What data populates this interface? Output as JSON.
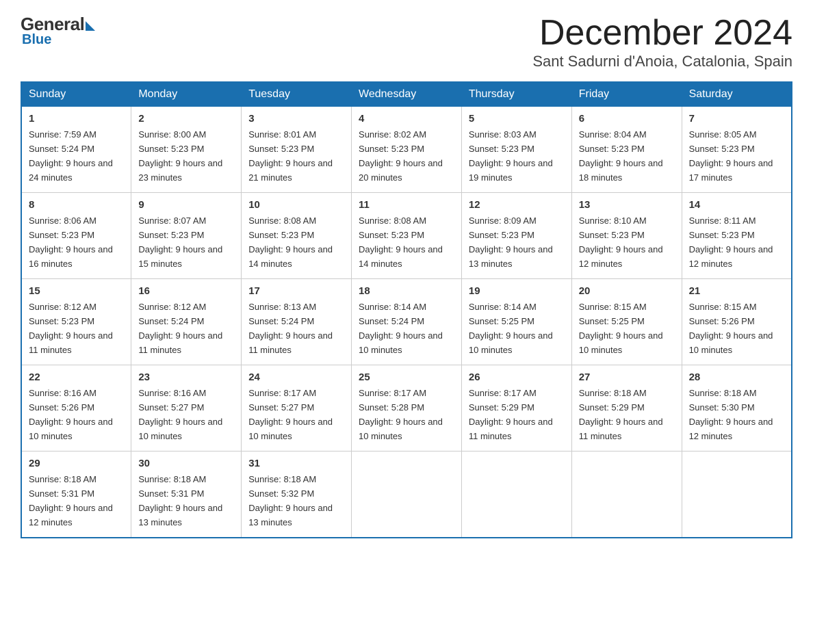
{
  "header": {
    "logo": {
      "general": "General",
      "blue": "Blue"
    },
    "title": "December 2024",
    "location": "Sant Sadurni d'Anoia, Catalonia, Spain"
  },
  "days_of_week": [
    "Sunday",
    "Monday",
    "Tuesday",
    "Wednesday",
    "Thursday",
    "Friday",
    "Saturday"
  ],
  "weeks": [
    [
      {
        "day": "1",
        "sunrise": "7:59 AM",
        "sunset": "5:24 PM",
        "daylight": "9 hours and 24 minutes."
      },
      {
        "day": "2",
        "sunrise": "8:00 AM",
        "sunset": "5:23 PM",
        "daylight": "9 hours and 23 minutes."
      },
      {
        "day": "3",
        "sunrise": "8:01 AM",
        "sunset": "5:23 PM",
        "daylight": "9 hours and 21 minutes."
      },
      {
        "day": "4",
        "sunrise": "8:02 AM",
        "sunset": "5:23 PM",
        "daylight": "9 hours and 20 minutes."
      },
      {
        "day": "5",
        "sunrise": "8:03 AM",
        "sunset": "5:23 PM",
        "daylight": "9 hours and 19 minutes."
      },
      {
        "day": "6",
        "sunrise": "8:04 AM",
        "sunset": "5:23 PM",
        "daylight": "9 hours and 18 minutes."
      },
      {
        "day": "7",
        "sunrise": "8:05 AM",
        "sunset": "5:23 PM",
        "daylight": "9 hours and 17 minutes."
      }
    ],
    [
      {
        "day": "8",
        "sunrise": "8:06 AM",
        "sunset": "5:23 PM",
        "daylight": "9 hours and 16 minutes."
      },
      {
        "day": "9",
        "sunrise": "8:07 AM",
        "sunset": "5:23 PM",
        "daylight": "9 hours and 15 minutes."
      },
      {
        "day": "10",
        "sunrise": "8:08 AM",
        "sunset": "5:23 PM",
        "daylight": "9 hours and 14 minutes."
      },
      {
        "day": "11",
        "sunrise": "8:08 AM",
        "sunset": "5:23 PM",
        "daylight": "9 hours and 14 minutes."
      },
      {
        "day": "12",
        "sunrise": "8:09 AM",
        "sunset": "5:23 PM",
        "daylight": "9 hours and 13 minutes."
      },
      {
        "day": "13",
        "sunrise": "8:10 AM",
        "sunset": "5:23 PM",
        "daylight": "9 hours and 12 minutes."
      },
      {
        "day": "14",
        "sunrise": "8:11 AM",
        "sunset": "5:23 PM",
        "daylight": "9 hours and 12 minutes."
      }
    ],
    [
      {
        "day": "15",
        "sunrise": "8:12 AM",
        "sunset": "5:23 PM",
        "daylight": "9 hours and 11 minutes."
      },
      {
        "day": "16",
        "sunrise": "8:12 AM",
        "sunset": "5:24 PM",
        "daylight": "9 hours and 11 minutes."
      },
      {
        "day": "17",
        "sunrise": "8:13 AM",
        "sunset": "5:24 PM",
        "daylight": "9 hours and 11 minutes."
      },
      {
        "day": "18",
        "sunrise": "8:14 AM",
        "sunset": "5:24 PM",
        "daylight": "9 hours and 10 minutes."
      },
      {
        "day": "19",
        "sunrise": "8:14 AM",
        "sunset": "5:25 PM",
        "daylight": "9 hours and 10 minutes."
      },
      {
        "day": "20",
        "sunrise": "8:15 AM",
        "sunset": "5:25 PM",
        "daylight": "9 hours and 10 minutes."
      },
      {
        "day": "21",
        "sunrise": "8:15 AM",
        "sunset": "5:26 PM",
        "daylight": "9 hours and 10 minutes."
      }
    ],
    [
      {
        "day": "22",
        "sunrise": "8:16 AM",
        "sunset": "5:26 PM",
        "daylight": "9 hours and 10 minutes."
      },
      {
        "day": "23",
        "sunrise": "8:16 AM",
        "sunset": "5:27 PM",
        "daylight": "9 hours and 10 minutes."
      },
      {
        "day": "24",
        "sunrise": "8:17 AM",
        "sunset": "5:27 PM",
        "daylight": "9 hours and 10 minutes."
      },
      {
        "day": "25",
        "sunrise": "8:17 AM",
        "sunset": "5:28 PM",
        "daylight": "9 hours and 10 minutes."
      },
      {
        "day": "26",
        "sunrise": "8:17 AM",
        "sunset": "5:29 PM",
        "daylight": "9 hours and 11 minutes."
      },
      {
        "day": "27",
        "sunrise": "8:18 AM",
        "sunset": "5:29 PM",
        "daylight": "9 hours and 11 minutes."
      },
      {
        "day": "28",
        "sunrise": "8:18 AM",
        "sunset": "5:30 PM",
        "daylight": "9 hours and 12 minutes."
      }
    ],
    [
      {
        "day": "29",
        "sunrise": "8:18 AM",
        "sunset": "5:31 PM",
        "daylight": "9 hours and 12 minutes."
      },
      {
        "day": "30",
        "sunrise": "8:18 AM",
        "sunset": "5:31 PM",
        "daylight": "9 hours and 13 minutes."
      },
      {
        "day": "31",
        "sunrise": "8:18 AM",
        "sunset": "5:32 PM",
        "daylight": "9 hours and 13 minutes."
      },
      null,
      null,
      null,
      null
    ]
  ]
}
